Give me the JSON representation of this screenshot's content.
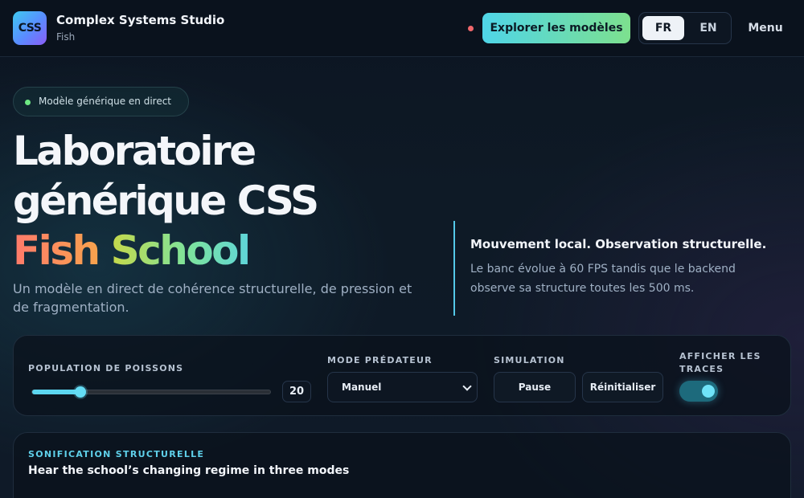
{
  "header": {
    "logo_text": "CSS",
    "brand_title": "Complex Systems Studio",
    "brand_subtitle": "Fish",
    "explore_label": "Explorer les modèles",
    "lang_options": [
      "FR",
      "EN"
    ],
    "lang_selected": "FR",
    "menu_label": "Menu",
    "status_color": "#f0676b"
  },
  "hero": {
    "live_badge": "Modèle générique en direct",
    "title_line1": "Laboratoire",
    "title_line2": "générique CSS",
    "title_word1": "Fish",
    "title_word2": "School",
    "description": "Un modèle en direct de cohérence structurelle, de pression et de fragmentation.",
    "side_title": "Mouvement local. Observation structurelle.",
    "side_text": "Le banc évolue à 60 FPS tandis que le backend observe sa structure toutes les 500 ms."
  },
  "controls": {
    "population_label": "POPULATION DE POISSONS",
    "population_value": "20",
    "population_fraction": 0.2,
    "predator_label": "MODE PRÉDATEUR",
    "predator_selected": "Manuel",
    "simulation_label": "SIMULATION",
    "pause_label": "Pause",
    "reset_label": "Réinitialiser",
    "traces_label_line1": "AFFICHER LES",
    "traces_label_line2": "TRACES",
    "traces_on": true
  },
  "sonification": {
    "kicker": "SONIFICATION STRUCTURELLE",
    "title": "Hear the school’s changing regime in three modes"
  },
  "colors": {
    "accent_cyan": "#5cd6f0",
    "accent_green": "#7de08e",
    "live_dot": "#6ee883"
  }
}
